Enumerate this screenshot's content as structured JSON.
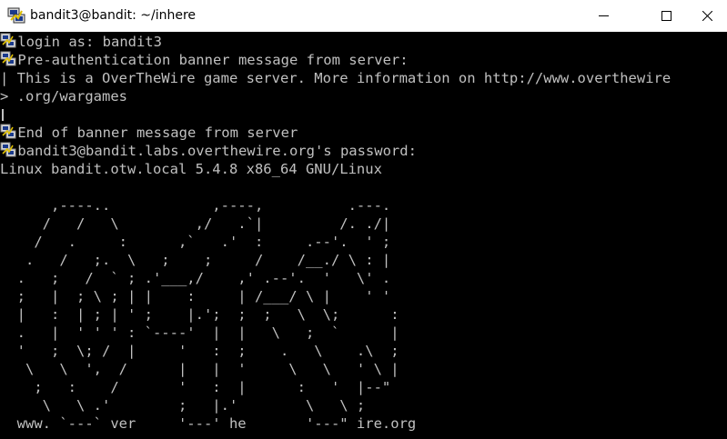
{
  "window": {
    "title": "bandit3@bandit: ~/inhere",
    "app_icon": "putty-icon",
    "controls": {
      "minimize_icon": "minimize-icon",
      "maximize_icon": "maximize-icon",
      "close_icon": "close-icon"
    },
    "colors": {
      "titlebar_bg": "#ffffff",
      "terminal_bg": "#000000",
      "terminal_fg": "#c0c0c0"
    }
  },
  "terminal": {
    "login_line": " login as: bandit3",
    "banner_start_line": " Pre-authentication banner message from server:",
    "banner_line_1": "| This is a OverTheWire game server. More information on http://www.overthewire",
    "banner_line_2": "> .org/wargames",
    "banner_end_line": " End of banner message from server",
    "password_prompt": " bandit3@bandit.labs.overthewire.org's password:",
    "system_line": "Linux bandit.otw.local 5.4.8 x86_64 GNU/Linux",
    "ascii_art": [
      "      ,----..            ,----,          .---.",
      "     /   /   \\         ,/   .`|         /. ./|",
      "    /   .     :      ,`   .'  :     .--'.  ' ;",
      "   .   /   ;.  \\   ;    ;     /    /__./ \\ : |",
      "  .   ;   /  ` ; .'___,/    ,' .--'.  '   \\' .",
      "  ;   |  ; \\ ; | |    :     | /___/ \\ |    ' '",
      "  |   :  | ; | ' ;    |.';  ;  ;   \\  \\;      :",
      "  .   |  ' ' ' : `----'  |  |   \\   ;  `      |",
      "  '   ;  \\; /  |     '   :  ;    .   \\    .\\  ;",
      "   \\   \\  ',  /      |   |  '     \\   \\   ' \\ |",
      "    ;   :    /       '   :  |      :   '  |--\"",
      "     \\   \\ .'        ;   |.'        \\   \\ ;",
      "  www. `---` ver     '---' he       '---\" ire.org"
    ]
  }
}
